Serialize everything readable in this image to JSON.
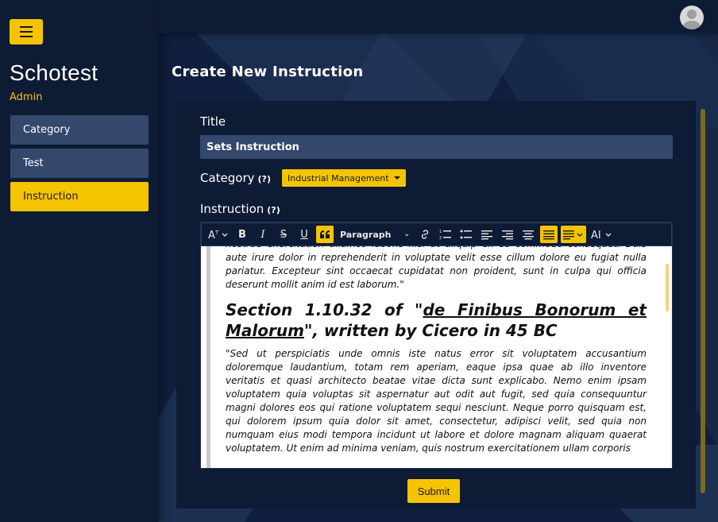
{
  "app": {
    "brand": "Schotest",
    "role": "Admin"
  },
  "sidebar": {
    "items": [
      {
        "label": "Category",
        "active": false
      },
      {
        "label": "Test",
        "active": false
      },
      {
        "label": "Instruction",
        "active": true
      }
    ]
  },
  "page": {
    "title": "Create New Instruction"
  },
  "form": {
    "title_label": "Title",
    "title_value": "Sets Instruction",
    "category_label": "Category",
    "category_help": "(?)",
    "category_value": "Industrial Management",
    "instruction_label": "Instruction",
    "instruction_help": "(?)",
    "submit_label": "Submit"
  },
  "editor": {
    "toolbar": {
      "paragraph_style": "Paragraph"
    },
    "content": {
      "p1": "nostrud exercitation ullamco laboris nisi ut aliquip ex ea commodo consequat. Duis aute irure dolor in reprehenderit in voluptate velit esse cillum dolore eu fugiat nulla pariatur. Excepteur sint occaecat cupidatat non proident, sunt in culpa qui officia deserunt mollit anim id est laborum.\"",
      "heading_pre": "Section 1.10.32 of \"",
      "heading_link": "de Finibus Bonorum et Malorum",
      "heading_post": "\", written by Cicero in 45 BC",
      "p2": "\"Sed ut perspiciatis unde omnis iste natus error sit voluptatem accusantium doloremque laudantium, totam rem aperiam, eaque ipsa quae ab illo inventore veritatis et quasi architecto beatae vitae dicta sunt explicabo. Nemo enim ipsam voluptatem quia voluptas sit aspernatur aut odit aut fugit, sed quia consequuntur magni dolores eos qui ratione voluptatem sequi nesciunt. Neque porro quisquam est, qui dolorem ipsum quia dolor sit amet, consectetur, adipisci velit, sed quia non numquam eius modi tempora incidunt ut labore et dolore magnam aliquam quaerat voluptatem. Ut enim ad minima veniam, quis nostrum exercitationem ullam corporis"
    }
  },
  "colors": {
    "accent": "#f5c400",
    "panel": "#0e1b35",
    "field": "#34486c"
  }
}
